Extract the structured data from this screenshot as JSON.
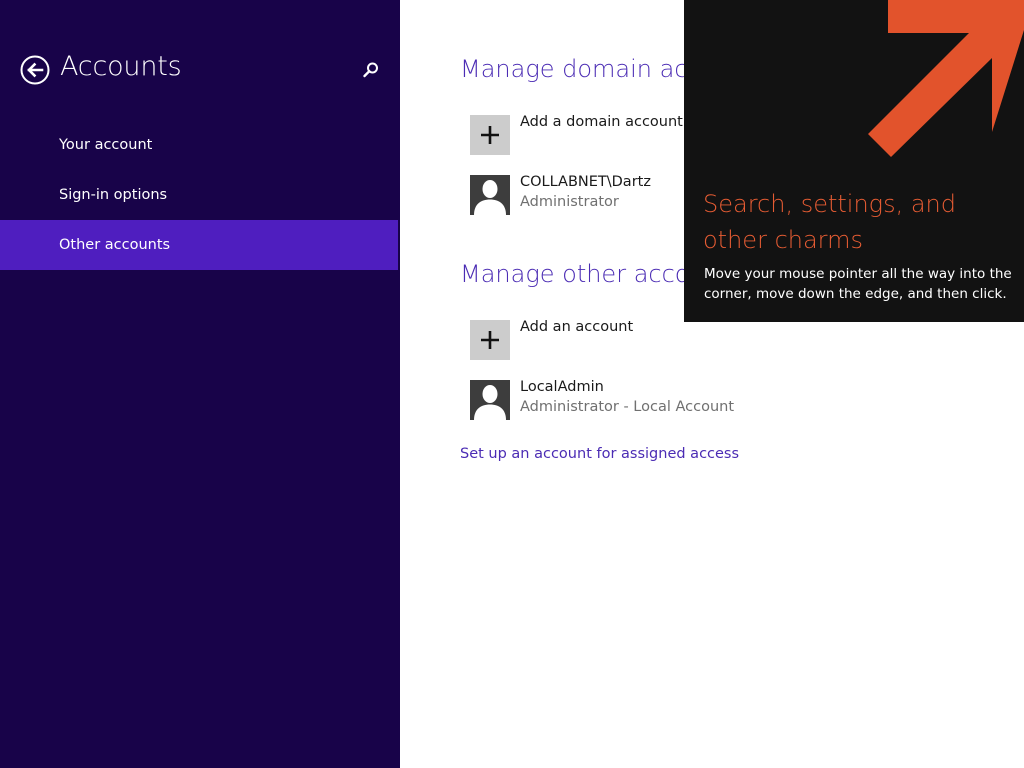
{
  "nav": {
    "title": "Accounts",
    "back_icon": "back-arrow-circle-icon",
    "search_icon": "search-icon",
    "items": [
      {
        "label": "Your account"
      },
      {
        "label": "Sign-in options"
      },
      {
        "label": "Other accounts",
        "selected": true
      }
    ]
  },
  "content": {
    "domain_section": {
      "heading": "Manage domain accounts",
      "add_label": "Add a domain account",
      "accounts": [
        {
          "name": "COLLABNET\\Dartz",
          "role": "Administrator"
        }
      ]
    },
    "other_section": {
      "heading": "Manage other accounts",
      "add_label": "Add an account",
      "accounts": [
        {
          "name": "LocalAdmin",
          "role": "Administrator - Local Account"
        }
      ]
    },
    "assigned_access_link": "Set up an account for assigned access"
  },
  "charms_tip": {
    "title": "Search, settings, and other charms",
    "body": "Move your mouse pointer all the way into the corner, move down the edge, and then click.",
    "arrow_icon": "diagonal-arrow-icon"
  },
  "colors": {
    "nav_background": "#180349",
    "nav_selected": "#4f1ebf",
    "accent": "#4b2cb4",
    "tip_background": "#121212",
    "tip_accent": "#e65c33"
  }
}
